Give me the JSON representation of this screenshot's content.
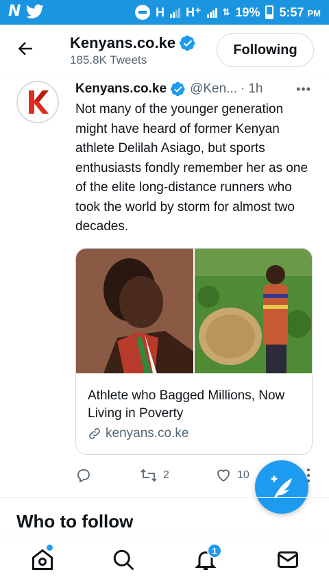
{
  "status_bar": {
    "network_left": "H",
    "network_right": "H⁺",
    "battery": "19%",
    "time": "5:57",
    "ampm": "PM"
  },
  "header": {
    "title": "Kenyans.co.ke",
    "subtitle": "185.8K Tweets",
    "follow_button": "Following"
  },
  "tweet": {
    "name": "Kenyans.co.ke",
    "handle": "@Ken...",
    "dot": "·",
    "time": "1h",
    "more": "•••",
    "text": "Not many of the younger generation might have heard of former Kenyan athlete Delilah Asiago, but sports enthusiasts fondly remember her as one of the elite long-distance runners who took the world by storm for almost two decades.",
    "card": {
      "title": "Athlete who Bagged Millions, Now Living in Poverty",
      "link": "kenyans.co.ke"
    },
    "actions": {
      "reply_count": "",
      "retweet_count": "2",
      "like_count": "10"
    }
  },
  "section": {
    "who_to_follow": "Who to follow"
  },
  "bottom_nav": {
    "notifications_badge": "1"
  },
  "colors": {
    "accent": "#1d9bf0",
    "status_bar": "#1b95e0",
    "text_primary": "#0f1419",
    "text_secondary": "#536471",
    "logo_red": "#e02b20"
  }
}
